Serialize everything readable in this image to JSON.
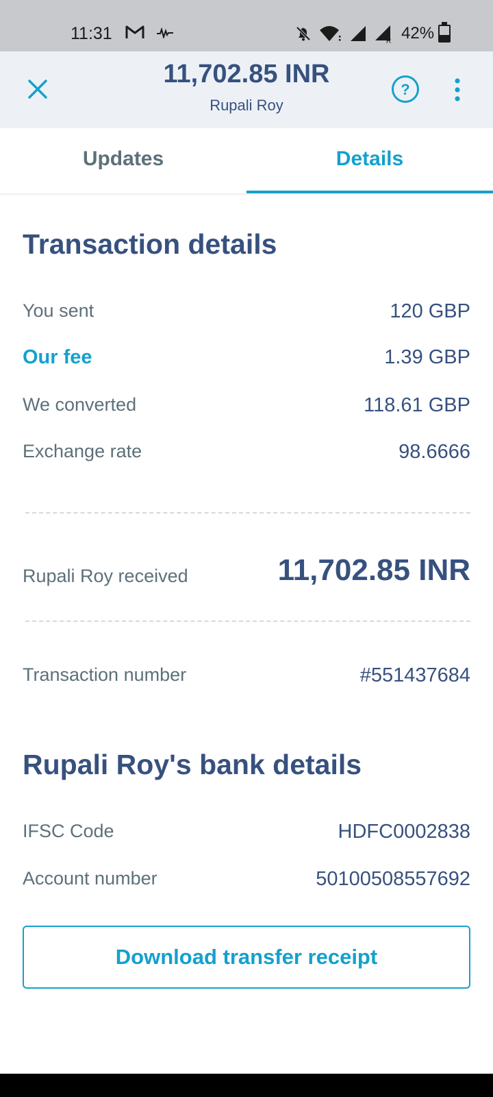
{
  "status_bar": {
    "time": "11:31",
    "battery_percent": "42%",
    "battery_level": 0.42,
    "icons": [
      "gmail-icon",
      "pulse-icon",
      "bell-off-icon",
      "wifi-icon",
      "signal-icon",
      "signal-roaming-icon",
      "battery-icon"
    ]
  },
  "header": {
    "amount": "11,702.85 INR",
    "recipient": "Rupali Roy",
    "icons": [
      "close-icon",
      "help-icon",
      "more-vertical-icon"
    ]
  },
  "tabs": [
    {
      "label": "Updates",
      "active": false
    },
    {
      "label": "Details",
      "active": true
    }
  ],
  "transaction": {
    "title": "Transaction details",
    "rows": [
      {
        "label": "You sent",
        "value": "120 GBP"
      },
      {
        "label": "Our fee",
        "value": "1.39 GBP"
      },
      {
        "label": "We converted",
        "value": "118.61 GBP"
      },
      {
        "label": "Exchange rate",
        "value": "98.6666"
      }
    ],
    "received": {
      "label": "Rupali Roy received",
      "value": "11,702.85 INR"
    },
    "number": {
      "label": "Transaction number",
      "value": "#551437684"
    }
  },
  "bank": {
    "title": "Rupali Roy's bank details",
    "rows": [
      {
        "label": "IFSC Code",
        "value": "HDFC0002838"
      },
      {
        "label": "Account number",
        "value": "50100508557692"
      }
    ]
  },
  "actions": {
    "download_receipt": "Download transfer receipt"
  },
  "colors": {
    "accent": "#14a1cc",
    "heading": "#37517e",
    "muted": "#5d7079",
    "header_bg": "#edf1f6"
  }
}
